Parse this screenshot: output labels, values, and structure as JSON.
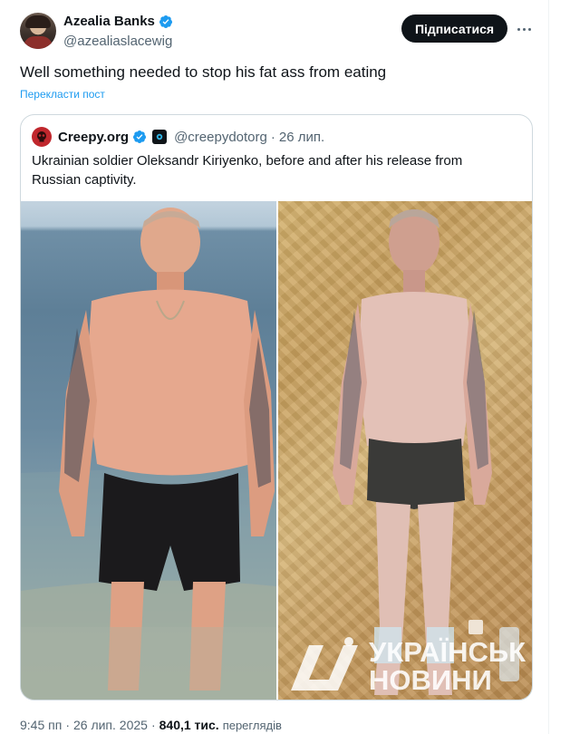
{
  "author": {
    "display_name": "Azealia Banks",
    "handle": "@azealiaslacewig",
    "verified_icon": "verified-badge-icon",
    "accent": "#1d9bf0"
  },
  "actions": {
    "follow_label": "Підписатися",
    "more_icon": "more-options-icon"
  },
  "tweet": {
    "text": "Well something needed to stop his fat ass from eating",
    "translate_label": "Перекласти пост"
  },
  "quote": {
    "display_name": "Creepy.org",
    "handle": "@creepydotorg",
    "separator": "·",
    "date": "26 лип.",
    "text": "Ukrainian soldier Oleksandr Kiriyenko, before and after his release from Russian captivity.",
    "media": {
      "left_photo": "photo-before",
      "right_photo": "photo-after",
      "watermark_line1": "УКРАЇНСЬК",
      "watermark_line2": "НОВИНИ"
    }
  },
  "meta": {
    "time": "9:45 пп",
    "separator": "·",
    "date": "26 лип. 2025",
    "views_count": "840,1 тис.",
    "views_label": "переглядів"
  }
}
